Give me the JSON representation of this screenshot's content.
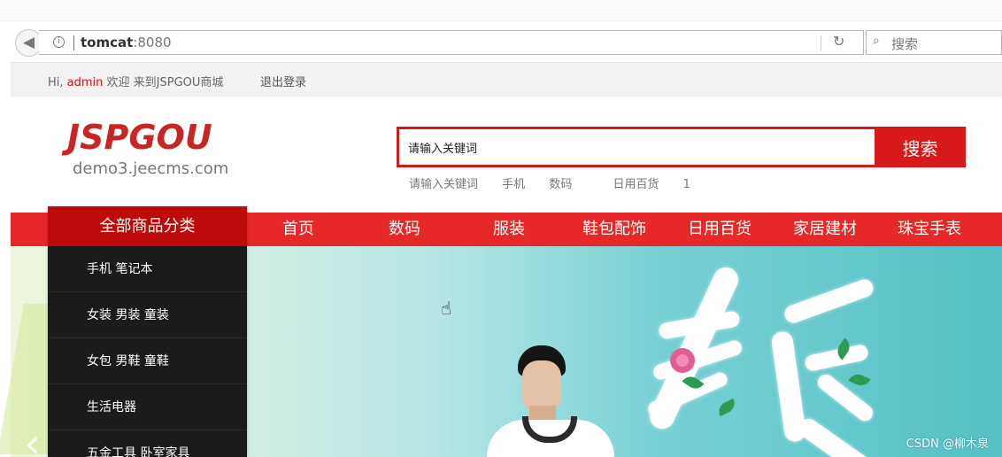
{
  "browser": {
    "url_host": "tomcat",
    "url_port": ":8080",
    "search_placeholder": "搜索",
    "reload_icon": "reload-icon",
    "info_icon": "info-icon"
  },
  "user_bar": {
    "prefix": "Hi, ",
    "username": "admin",
    "welcome": " 欢迎 来到JSPGOU商城",
    "logout": "退出登录"
  },
  "site": {
    "logo": "JSPGOU",
    "domain": "demo3.jeecms.com"
  },
  "search": {
    "input_value": "请输入关键词",
    "button_label": "搜索",
    "hot_words": [
      "请输入关键词",
      "手机",
      "数码",
      "日用百货",
      "1"
    ]
  },
  "nav": {
    "category_title": "全部商品分类",
    "items": [
      "首页",
      "数码",
      "服装",
      "鞋包配饰",
      "日用百货",
      "家居建材",
      "珠宝手表"
    ]
  },
  "categories": [
    "手机 笔记本",
    "女装 男装 童装",
    "女包 男鞋 童鞋",
    "生活电器",
    "五金工具 卧室家具"
  ],
  "banner": {
    "calligraphy": "春夏"
  },
  "watermark": "CSDN @柳木泉",
  "colors": {
    "brand_red": "#d71919",
    "nav_red": "#e62828",
    "dark_menu": "#1b1b1b"
  }
}
